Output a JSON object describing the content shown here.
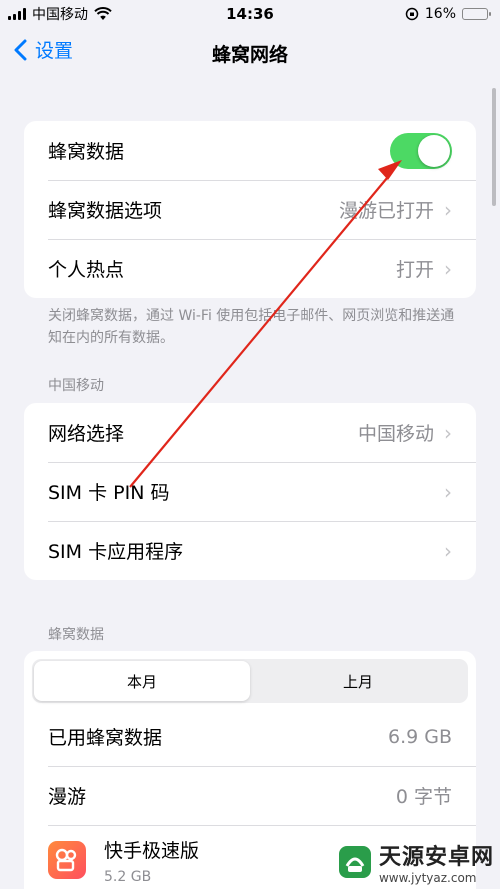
{
  "status_bar": {
    "carrier": "中国移动",
    "time": "14:36",
    "battery_percent": "16%",
    "battery_level": 0.16,
    "battery_color": "#e53935"
  },
  "nav": {
    "back_label": "设置",
    "title": "蜂窝网络"
  },
  "group1": {
    "cellular_data": {
      "label": "蜂窝数据",
      "enabled": true
    },
    "data_options": {
      "label": "蜂窝数据选项",
      "value": "漫游已打开"
    },
    "hotspot": {
      "label": "个人热点",
      "value": "打开"
    }
  },
  "group1_footnote": "关闭蜂窝数据，通过 Wi-Fi 使用包括电子邮件、网页浏览和推送通知在内的所有数据。",
  "carrier_section": {
    "header": "中国移动",
    "network_selection": {
      "label": "网络选择",
      "value": "中国移动"
    },
    "sim_pin": {
      "label": "SIM 卡 PIN 码"
    },
    "sim_apps": {
      "label": "SIM 卡应用程序"
    }
  },
  "usage_section": {
    "header": "蜂窝数据",
    "tabs": [
      "本月",
      "上月"
    ],
    "selected_tab": "本月",
    "used": {
      "label": "已用蜂窝数据",
      "value": "6.9 GB"
    },
    "roaming": {
      "label": "漫游",
      "value": "0 字节"
    },
    "apps": [
      {
        "name": "快手极速版",
        "size": "5.2 GB",
        "icon": "kuaishou-icon"
      }
    ]
  },
  "watermark": {
    "title": "天源安卓网",
    "url": "www.jytyaz.com"
  },
  "colors": {
    "accent": "#007aff",
    "toggle_on": "#4cd964",
    "annotation_arrow": "#e0261b"
  }
}
